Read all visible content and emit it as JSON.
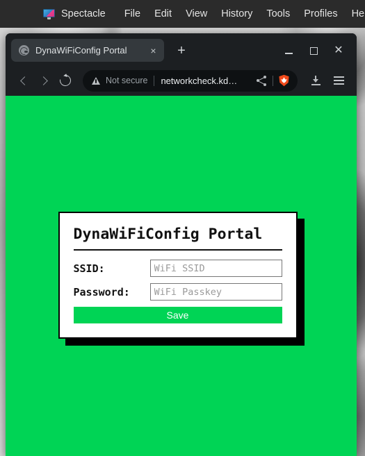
{
  "desktop": {
    "menubar": {
      "app_icon": "spectacle-monitor-icon",
      "app_name": "Spectacle",
      "items": [
        {
          "label": "File"
        },
        {
          "label": "Edit"
        },
        {
          "label": "View"
        },
        {
          "label": "History"
        },
        {
          "label": "Tools"
        },
        {
          "label": "Profiles"
        },
        {
          "label": "Help"
        }
      ]
    }
  },
  "browser": {
    "tab": {
      "favicon": "globe-icon",
      "title": "DynaWiFiConfig Portal",
      "close_label": "×"
    },
    "new_tab_label": "+",
    "window_controls": {
      "minimize": "minimize-icon",
      "maximize": "maximize-icon",
      "close_label": "✕"
    },
    "toolbar": {
      "back": "back-icon",
      "forward": "forward-icon",
      "reload": "reload-icon",
      "security_status": "Not secure",
      "url": "networkcheck.kd…",
      "share": "share-icon",
      "shield": "brave-shield-icon",
      "downloads": "download-icon",
      "app_menu": "hamburger-menu-icon"
    }
  },
  "page": {
    "background_color": "#00d455",
    "card": {
      "title": "DynaWiFiConfig Portal",
      "fields": [
        {
          "label": "SSID:",
          "value": "",
          "placeholder": "WiFi SSID",
          "type": "text"
        },
        {
          "label": "Password:",
          "value": "",
          "placeholder": "WiFi Passkey",
          "type": "text"
        }
      ],
      "save_label": "Save",
      "accent_color": "#00d455",
      "border_color": "#000000"
    }
  }
}
